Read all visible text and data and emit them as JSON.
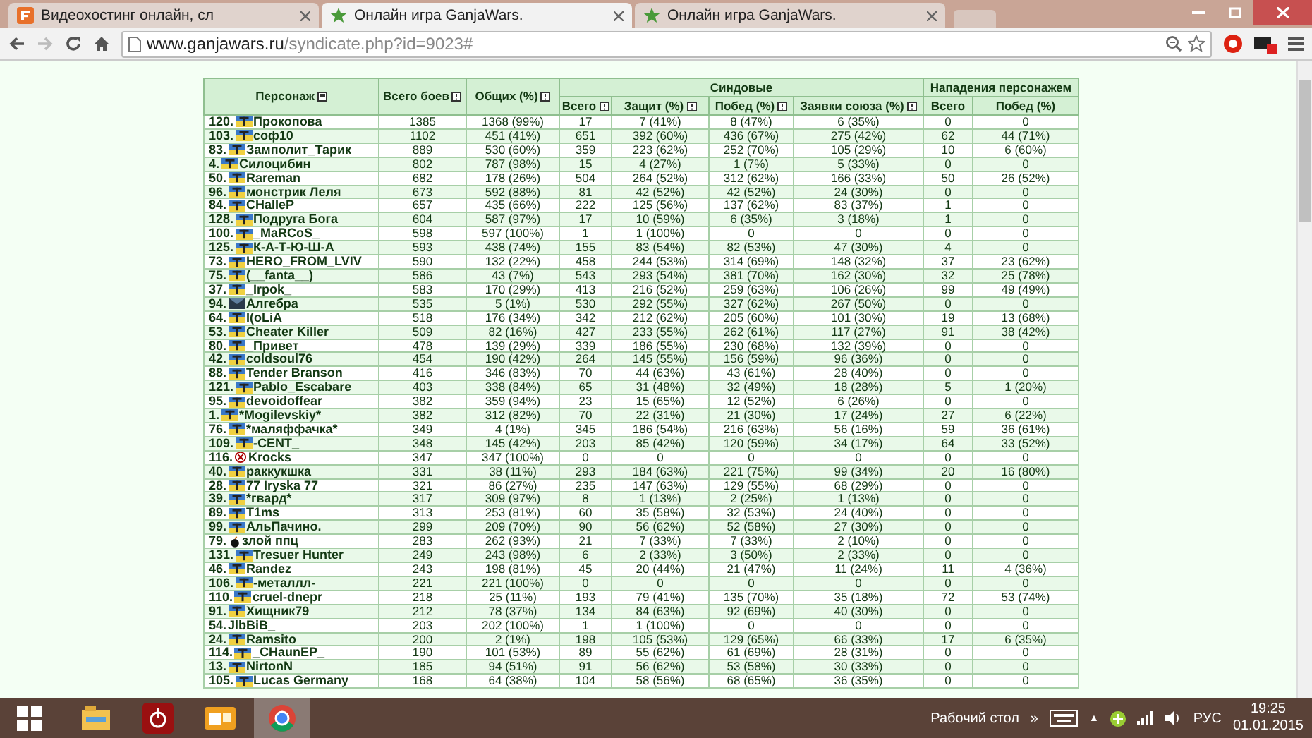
{
  "tabs": [
    {
      "label": "Видеохостинг онлайн, сл",
      "selected": false
    },
    {
      "label": "Онлайн игра GanjaWars.",
      "selected": true
    },
    {
      "label": "Онлайн игра GanjaWars.",
      "selected": false
    }
  ],
  "address": {
    "host": "www.ganjawars.ru",
    "path": "/syndicate.php?id=9023#"
  },
  "table": {
    "group_headers": [
      "Синдовые",
      "Нападения персонажем"
    ],
    "columns": [
      "Персонаж",
      "Всего боев",
      "Общих (%)",
      "Всего",
      "Защит (%)",
      "Побед (%)",
      "Заявки союза (%)",
      "Всего",
      "Побед (%)"
    ],
    "rows": [
      {
        "kind": "flag",
        "cells": [
          {
            "rank": "120.",
            "name": "Прокопова"
          },
          "1385",
          "1368 (99%)",
          "17",
          "7 (41%)",
          "8 (47%)",
          "6 (35%)",
          "0",
          "0"
        ]
      },
      {
        "kind": "flag",
        "cells": [
          {
            "rank": "103.",
            "name": "соф10"
          },
          "1102",
          "451 (41%)",
          "651",
          "392 (60%)",
          "436 (67%)",
          "275 (42%)",
          "62",
          "44 (71%)"
        ]
      },
      {
        "kind": "flag",
        "cells": [
          {
            "rank": "83.",
            "name": "Замполит_Тарик"
          },
          "889",
          "530 (60%)",
          "359",
          "223 (62%)",
          "252 (70%)",
          "105 (29%)",
          "10",
          "6 (60%)"
        ]
      },
      {
        "kind": "flag",
        "cells": [
          {
            "rank": "4.",
            "name": "Силоцибин"
          },
          "802",
          "787 (98%)",
          "15",
          "4 (27%)",
          "1 (7%)",
          "5 (33%)",
          "0",
          "0"
        ]
      },
      {
        "kind": "flag",
        "cells": [
          {
            "rank": "50.",
            "name": "Rareman"
          },
          "682",
          "178 (26%)",
          "504",
          "264 (52%)",
          "312 (62%)",
          "166 (33%)",
          "50",
          "26 (52%)"
        ]
      },
      {
        "kind": "flag",
        "cells": [
          {
            "rank": "96.",
            "name": "монстрик Леля"
          },
          "673",
          "592 (88%)",
          "81",
          "42 (52%)",
          "42 (52%)",
          "24 (30%)",
          "0",
          "0"
        ]
      },
      {
        "kind": "flag",
        "cells": [
          {
            "rank": "84.",
            "name": "CHaIIeP"
          },
          "657",
          "435 (66%)",
          "222",
          "125 (56%)",
          "137 (62%)",
          "83 (37%)",
          "1",
          "0"
        ]
      },
      {
        "kind": "flag",
        "cells": [
          {
            "rank": "128.",
            "name": "Подруга Бога"
          },
          "604",
          "587 (97%)",
          "17",
          "10 (59%)",
          "6 (35%)",
          "3 (18%)",
          "1",
          "0"
        ]
      },
      {
        "kind": "flag",
        "cells": [
          {
            "rank": "100.",
            "name": "_MaRCoS_"
          },
          "598",
          "597 (100%)",
          "1",
          "1 (100%)",
          "0",
          "0",
          "0",
          "0"
        ]
      },
      {
        "kind": "flag",
        "cells": [
          {
            "rank": "125.",
            "name": "К-А-Т-Ю-Ш-А"
          },
          "593",
          "438 (74%)",
          "155",
          "83 (54%)",
          "82 (53%)",
          "47 (30%)",
          "4",
          "0"
        ]
      },
      {
        "kind": "flag",
        "cells": [
          {
            "rank": "73.",
            "name": "HERO_FROM_LVIV"
          },
          "590",
          "132 (22%)",
          "458",
          "244 (53%)",
          "314 (69%)",
          "148 (32%)",
          "37",
          "23 (62%)"
        ]
      },
      {
        "kind": "flag",
        "cells": [
          {
            "rank": "75.",
            "name": "(__fanta__)"
          },
          "586",
          "43 (7%)",
          "543",
          "293 (54%)",
          "381 (70%)",
          "162 (30%)",
          "32",
          "25 (78%)"
        ]
      },
      {
        "kind": "flag",
        "cells": [
          {
            "rank": "37.",
            "name": "_Irpok_"
          },
          "583",
          "170 (29%)",
          "413",
          "216 (52%)",
          "259 (63%)",
          "106 (26%)",
          "99",
          "49 (49%)"
        ]
      },
      {
        "kind": "dark",
        "cells": [
          {
            "rank": "94.",
            "name": "Алгебра"
          },
          "535",
          "5 (1%)",
          "530",
          "292 (55%)",
          "327 (62%)",
          "267 (50%)",
          "0",
          "0"
        ]
      },
      {
        "kind": "flag",
        "cells": [
          {
            "rank": "64.",
            "name": "I(oLiA"
          },
          "518",
          "176 (34%)",
          "342",
          "212 (62%)",
          "205 (60%)",
          "101 (30%)",
          "19",
          "13 (68%)"
        ]
      },
      {
        "kind": "flag",
        "cells": [
          {
            "rank": "53.",
            "name": "Cheater Killer"
          },
          "509",
          "82 (16%)",
          "427",
          "233 (55%)",
          "262 (61%)",
          "117 (27%)",
          "91",
          "38 (42%)"
        ]
      },
      {
        "kind": "flag",
        "cells": [
          {
            "rank": "80.",
            "name": "_Привет_"
          },
          "478",
          "139 (29%)",
          "339",
          "186 (55%)",
          "230 (68%)",
          "132 (39%)",
          "0",
          "0"
        ]
      },
      {
        "kind": "flag",
        "cells": [
          {
            "rank": "42.",
            "name": "coldsoul76"
          },
          "454",
          "190 (42%)",
          "264",
          "145 (55%)",
          "156 (59%)",
          "96 (36%)",
          "0",
          "0"
        ]
      },
      {
        "kind": "flag",
        "cells": [
          {
            "rank": "88.",
            "name": "Tender Branson"
          },
          "416",
          "346 (83%)",
          "70",
          "44 (63%)",
          "43 (61%)",
          "28 (40%)",
          "0",
          "0"
        ]
      },
      {
        "kind": "flag",
        "cells": [
          {
            "rank": "121.",
            "name": "Pablo_Escabare"
          },
          "403",
          "338 (84%)",
          "65",
          "31 (48%)",
          "32 (49%)",
          "18 (28%)",
          "5",
          "1 (20%)"
        ]
      },
      {
        "kind": "flag",
        "cells": [
          {
            "rank": "95.",
            "name": "devoidoffear"
          },
          "382",
          "359 (94%)",
          "23",
          "15 (65%)",
          "12 (52%)",
          "6 (26%)",
          "0",
          "0"
        ]
      },
      {
        "kind": "flag",
        "cells": [
          {
            "rank": "1.",
            "name": "*Mogilevskiy*"
          },
          "382",
          "312 (82%)",
          "70",
          "22 (31%)",
          "21 (30%)",
          "17 (24%)",
          "27",
          "6 (22%)"
        ]
      },
      {
        "kind": "flag",
        "cells": [
          {
            "rank": "76.",
            "name": "*маляффачка*"
          },
          "349",
          "4 (1%)",
          "345",
          "186 (54%)",
          "216 (63%)",
          "56 (16%)",
          "59",
          "36 (61%)"
        ]
      },
      {
        "kind": "flag",
        "cells": [
          {
            "rank": "109.",
            "name": "-CENT_"
          },
          "348",
          "145 (42%)",
          "203",
          "85 (42%)",
          "120 (59%)",
          "34 (17%)",
          "64",
          "33 (52%)"
        ]
      },
      {
        "kind": "cross",
        "cells": [
          {
            "rank": "116.",
            "name": "Krocks"
          },
          "347",
          "347 (100%)",
          "0",
          "0",
          "0",
          "0",
          "0",
          "0"
        ]
      },
      {
        "kind": "flag",
        "cells": [
          {
            "rank": "40.",
            "name": "раккукшка"
          },
          "331",
          "38 (11%)",
          "293",
          "184 (63%)",
          "221 (75%)",
          "99 (34%)",
          "20",
          "16 (80%)"
        ]
      },
      {
        "kind": "flag",
        "cells": [
          {
            "rank": "28.",
            "name": "77 Iryska 77"
          },
          "321",
          "86 (27%)",
          "235",
          "147 (63%)",
          "129 (55%)",
          "68 (29%)",
          "0",
          "0"
        ]
      },
      {
        "kind": "flag",
        "cells": [
          {
            "rank": "39.",
            "name": "*гвард*"
          },
          "317",
          "309 (97%)",
          "8",
          "1 (13%)",
          "2 (25%)",
          "1 (13%)",
          "0",
          "0"
        ]
      },
      {
        "kind": "flag",
        "cells": [
          {
            "rank": "89.",
            "name": "T1ms"
          },
          "313",
          "253 (81%)",
          "60",
          "35 (58%)",
          "32 (53%)",
          "24 (40%)",
          "0",
          "0"
        ]
      },
      {
        "kind": "flag",
        "cells": [
          {
            "rank": "99.",
            "name": "АльПачино."
          },
          "299",
          "209 (70%)",
          "90",
          "56 (62%)",
          "52 (58%)",
          "27 (30%)",
          "0",
          "0"
        ]
      },
      {
        "kind": "bomb",
        "cells": [
          {
            "rank": "79.",
            "name": "злой ппц"
          },
          "283",
          "262 (93%)",
          "21",
          "7 (33%)",
          "7 (33%)",
          "2 (10%)",
          "0",
          "0"
        ]
      },
      {
        "kind": "flag",
        "cells": [
          {
            "rank": "131.",
            "name": "Tresuer Hunter"
          },
          "249",
          "243 (98%)",
          "6",
          "2 (33%)",
          "3 (50%)",
          "2 (33%)",
          "0",
          "0"
        ]
      },
      {
        "kind": "flag",
        "cells": [
          {
            "rank": "46.",
            "name": "Randez"
          },
          "243",
          "198 (81%)",
          "45",
          "20 (44%)",
          "21 (47%)",
          "11 (24%)",
          "11",
          "4 (36%)"
        ]
      },
      {
        "kind": "flag",
        "cells": [
          {
            "rank": "106.",
            "name": "-металлл-"
          },
          "221",
          "221 (100%)",
          "0",
          "0",
          "0",
          "0",
          "0",
          "0"
        ]
      },
      {
        "kind": "flag",
        "cells": [
          {
            "rank": "110.",
            "name": "cruel-dnepr"
          },
          "218",
          "25 (11%)",
          "193",
          "79 (41%)",
          "135 (70%)",
          "35 (18%)",
          "72",
          "53 (74%)"
        ]
      },
      {
        "kind": "flag",
        "cells": [
          {
            "rank": "91.",
            "name": "Хищник79"
          },
          "212",
          "78 (37%)",
          "134",
          "84 (63%)",
          "92 (69%)",
          "40 (30%)",
          "0",
          "0"
        ]
      },
      {
        "kind": "plain",
        "cells": [
          {
            "rank": "54.",
            "name": "JlbBiB_"
          },
          "203",
          "202 (100%)",
          "1",
          "1 (100%)",
          "0",
          "0",
          "0",
          "0"
        ]
      },
      {
        "kind": "flag",
        "cells": [
          {
            "rank": "24.",
            "name": "Ramsito"
          },
          "200",
          "2 (1%)",
          "198",
          "105 (53%)",
          "129 (65%)",
          "66 (33%)",
          "17",
          "6 (35%)"
        ]
      },
      {
        "kind": "flag",
        "cells": [
          {
            "rank": "114.",
            "name": "_CHaunEP_"
          },
          "190",
          "101 (53%)",
          "89",
          "55 (62%)",
          "61 (69%)",
          "28 (31%)",
          "0",
          "0"
        ]
      },
      {
        "kind": "flag",
        "cells": [
          {
            "rank": "13.",
            "name": "NirtonN"
          },
          "185",
          "94 (51%)",
          "91",
          "56 (62%)",
          "53 (58%)",
          "30 (33%)",
          "0",
          "0"
        ]
      },
      {
        "kind": "flag",
        "cells": [
          {
            "rank": "105.",
            "name": "Lucas Germany"
          },
          "168",
          "64 (38%)",
          "104",
          "58 (56%)",
          "68 (65%)",
          "36 (35%)",
          "0",
          "0"
        ]
      }
    ]
  },
  "taskbar": {
    "apps": [
      {
        "selected": false
      },
      {
        "selected": false
      },
      {
        "selected": false
      },
      {
        "selected": true
      }
    ],
    "desktop_label": "Рабочий стол",
    "chevron": "»",
    "tray_arrow": "▲",
    "language": "РУС",
    "time": "19:25",
    "date": "01.01.2015"
  }
}
